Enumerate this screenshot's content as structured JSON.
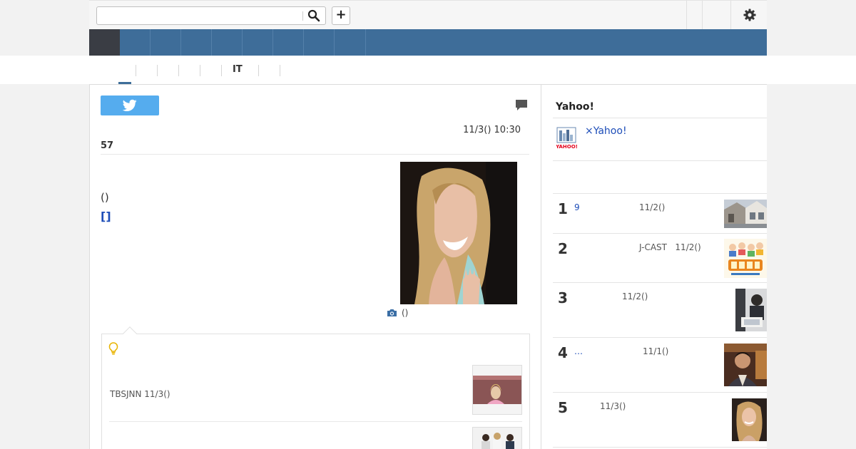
{
  "header": {
    "search_placeholder": "",
    "add_label": "+"
  },
  "subnav": {
    "visible_label": "IT"
  },
  "article": {
    "date": "11/3() 10:30",
    "count": "57",
    "body_text": "()",
    "link_text": "[]",
    "photo_caption": "()",
    "related": {
      "source": "TBSJNN 11/3()"
    }
  },
  "sidebar": {
    "title": "Yahoo!",
    "promo_link": "×Yahoo!",
    "ranking": [
      {
        "rank": "1",
        "title": "9",
        "meta": "11/2()"
      },
      {
        "rank": "2",
        "title": "",
        "meta": "J-CAST   11/2()"
      },
      {
        "rank": "3",
        "title": "",
        "meta": "11/2()"
      },
      {
        "rank": "4",
        "title": "…",
        "meta": "11/1()"
      },
      {
        "rank": "5",
        "title": "",
        "meta": "11/3()"
      }
    ]
  },
  "colors": {
    "nav_blue": "#3e6d99",
    "nav_active": "#3a3d44",
    "twitter_blue": "#55acee",
    "link_blue": "#1d4db8"
  },
  "icons": [
    "search-icon",
    "plus-icon",
    "gear-icon",
    "twitter-icon",
    "comment-icon",
    "camera-icon",
    "lightbulb-icon",
    "yahoo-logo"
  ]
}
